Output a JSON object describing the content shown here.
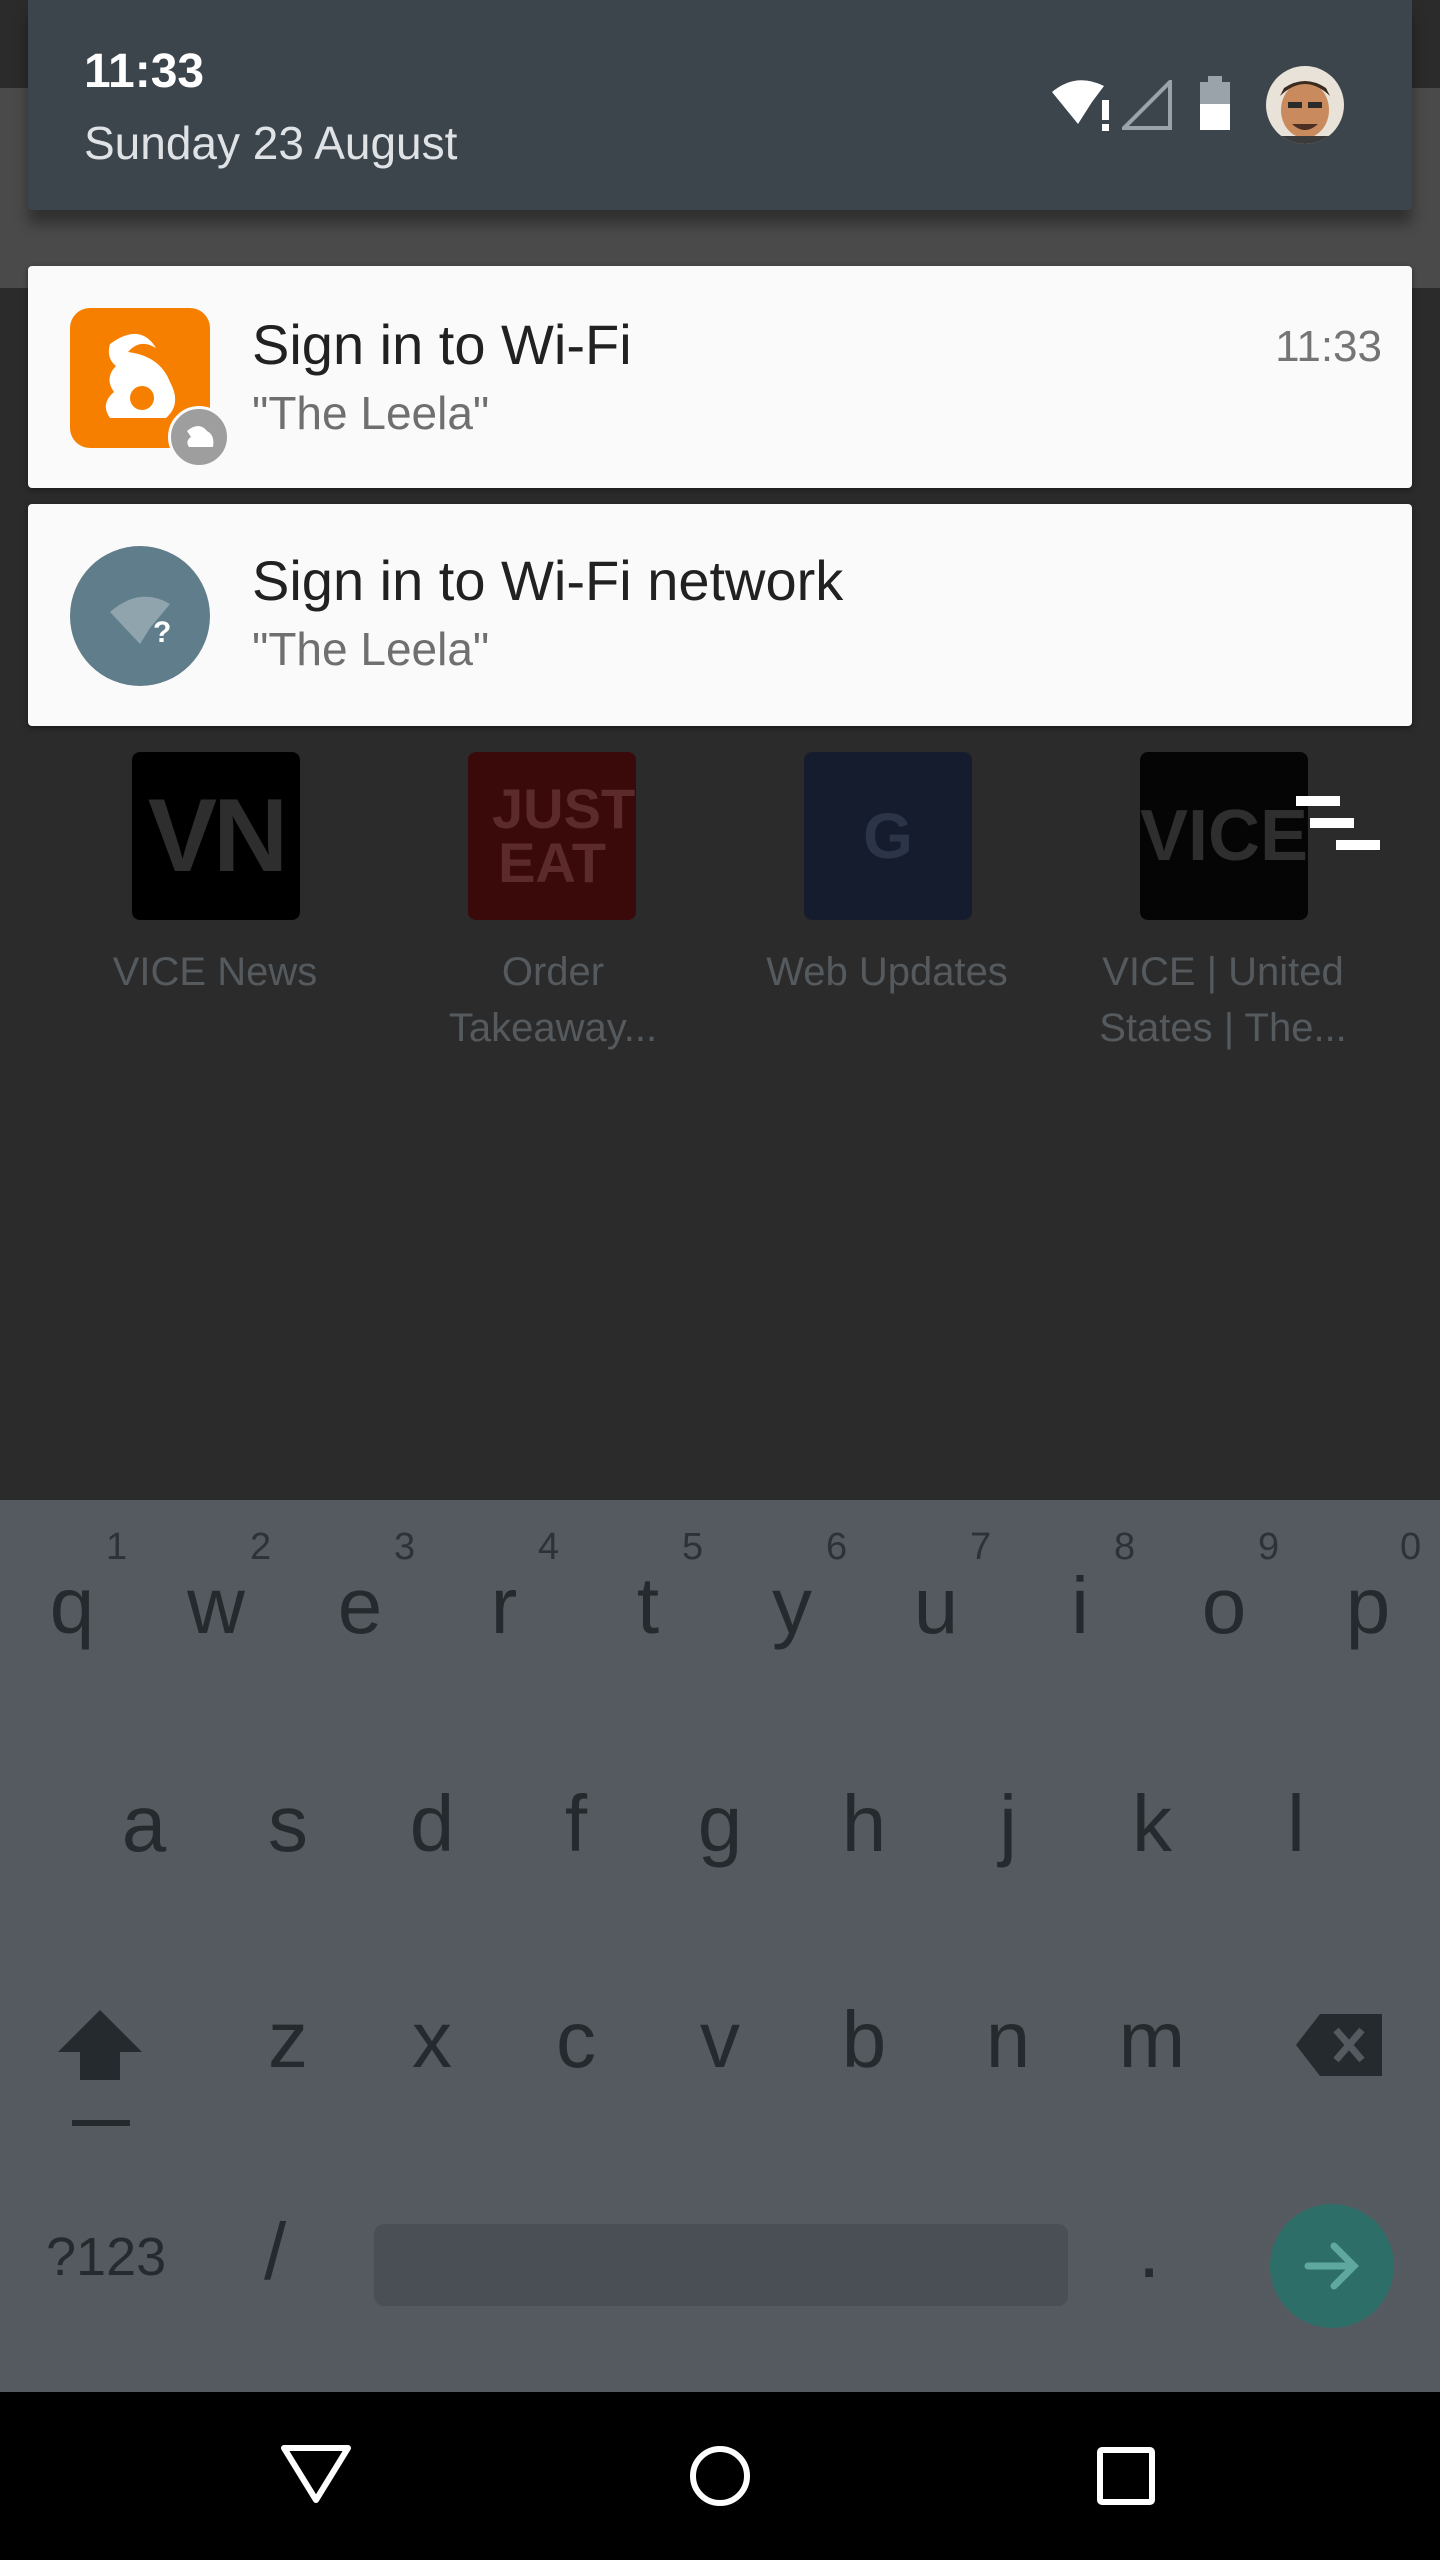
{
  "shade": {
    "time": "11:33",
    "date": "Sunday 23 August"
  },
  "notifications": [
    {
      "title": "Sign in to Wi-Fi",
      "subtitle": "\"The Leela\"",
      "time": "11:33",
      "icon": "uc-browser-icon"
    },
    {
      "title": "Sign in to Wi-Fi network",
      "subtitle": "\"The Leela\"",
      "icon": "wifi-question-icon"
    }
  ],
  "tiles": [
    {
      "glyph": "VN",
      "label1": "VICE News",
      "label2": "",
      "color": "#000000"
    },
    {
      "glyph": "JUST EAT",
      "label1": "Order",
      "label2": "Takeaway...",
      "color": "#3a0a0a"
    },
    {
      "glyph": "G",
      "label1": "Web Updates",
      "label2": "",
      "color": "#151c2e"
    },
    {
      "glyph": "VICE",
      "label1": "VICE | United",
      "label2": "States | The...",
      "color": "#050505"
    }
  ],
  "keyboard": {
    "row1": [
      "q",
      "w",
      "e",
      "r",
      "t",
      "y",
      "u",
      "i",
      "o",
      "p"
    ],
    "hints": [
      "1",
      "2",
      "3",
      "4",
      "5",
      "6",
      "7",
      "8",
      "9",
      "0"
    ],
    "row2": [
      "a",
      "s",
      "d",
      "f",
      "g",
      "h",
      "j",
      "k",
      "l"
    ],
    "row3": [
      "z",
      "x",
      "c",
      "v",
      "b",
      "n",
      "m"
    ],
    "symbols_key": "?123",
    "slash_key": "/",
    "period_key": "."
  },
  "colors": {
    "shade": "#3c444c",
    "uc_orange": "#f77f00",
    "wifi_icon_bg": "#607d8b",
    "enter_key": "#2e6e68"
  }
}
